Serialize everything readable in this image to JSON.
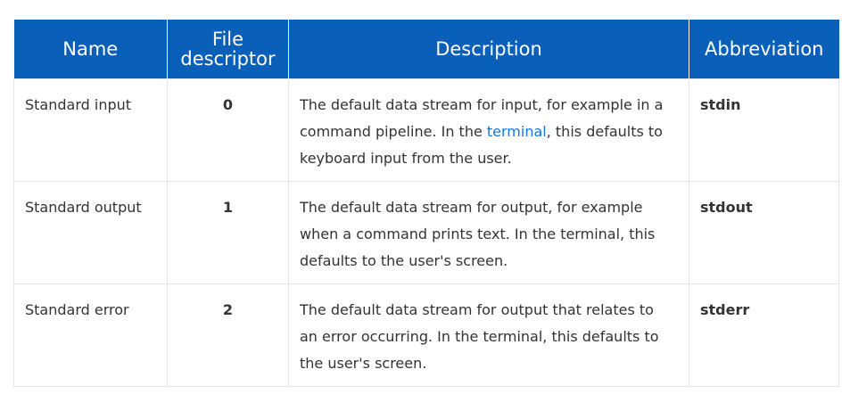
{
  "table": {
    "headers": {
      "name": "Name",
      "file_descriptor_line1": "File",
      "file_descriptor_line2": "descriptor",
      "description": "Description",
      "abbreviation": "Abbreviation"
    },
    "rows": [
      {
        "name": "Standard input",
        "fd": "0",
        "desc_before_link": "The default data stream for input, for example in a command pipeline. In the ",
        "desc_link": "terminal",
        "desc_after_link": ", this defaults to keyboard input from the user.",
        "abbr": "stdin"
      },
      {
        "name": "Standard output",
        "fd": "1",
        "desc": "The default data stream for output, for example when a command prints text. In the terminal, this defaults to the user's screen.",
        "abbr": "stdout"
      },
      {
        "name": "Standard error",
        "fd": "2",
        "desc": "The default data stream for output that relates to an error occurring. In the terminal, this defaults to the user's screen.",
        "abbr": "stderr"
      }
    ]
  },
  "colors": {
    "header_bg": "#0a5fb8",
    "link": "#1a73d9"
  }
}
